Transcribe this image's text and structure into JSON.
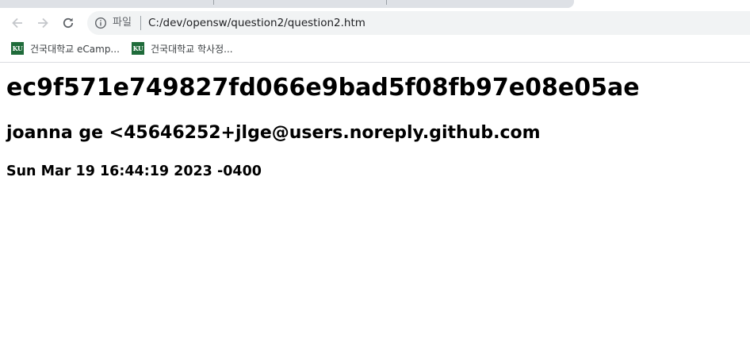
{
  "toolbar": {
    "scheme_label": "파일",
    "url": "C:/dev/opensw/question2/question2.htm"
  },
  "bookmarks": [
    {
      "icon_text": "KU",
      "label": "건국대학교 eCamp..."
    },
    {
      "icon_text": "KU",
      "label": "건국대학교 학사정..."
    }
  ],
  "content": {
    "commit_hash": "ec9f571e749827fd066e9bad5f08fb97e08e05ae",
    "author": "joanna ge <45646252+jlge@users.noreply.github.com",
    "date": "Sun Mar 19 16:44:19 2023 -0400"
  },
  "colors": {
    "tab_strip": "#dee1e6",
    "omnibox_bg": "#f1f3f4",
    "icon_gray": "#5f6368",
    "ku_green": "#1f6b3a"
  }
}
